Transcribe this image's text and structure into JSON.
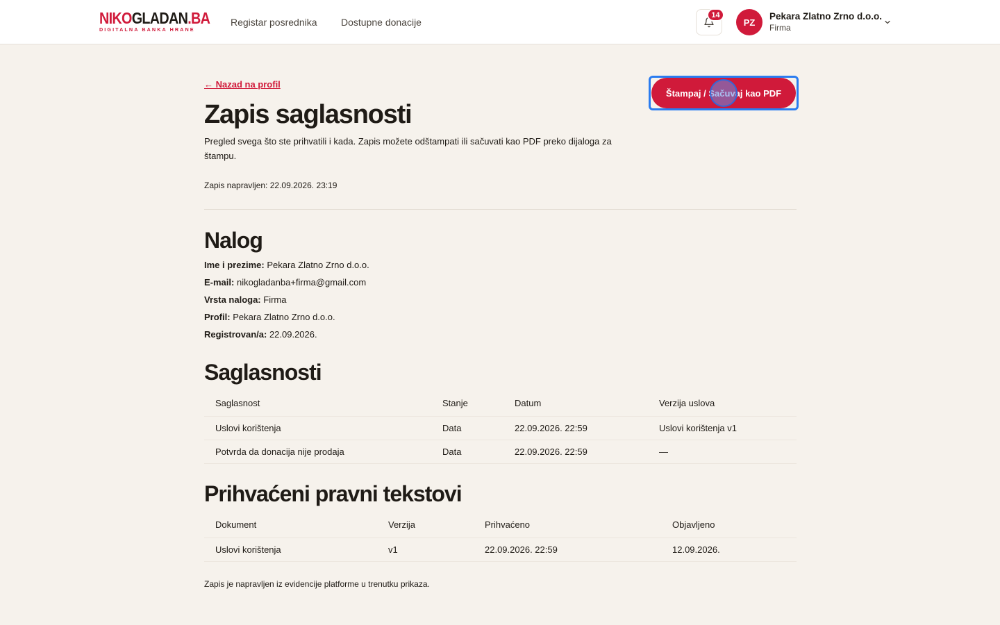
{
  "header": {
    "logo": {
      "part1": "NIKO",
      "part2": "GLADAN",
      "part3": ".BA",
      "tagline": "DIGITALNA BANKA HRANE"
    },
    "nav": [
      {
        "label": "Registar posrednika"
      },
      {
        "label": "Dostupne donacije"
      }
    ],
    "notifications_count": "14",
    "user": {
      "initials": "PZ",
      "name": "Pekara Zlatno Zrno d.o.o.",
      "role": "Firma"
    }
  },
  "page": {
    "back_link": "← Nazad na profil",
    "title": "Zapis saglasnosti",
    "intro": "Pregled svega što ste prihvatili i kada. Zapis možete odštampati ili sačuvati kao PDF preko dijaloga za štampu.",
    "made_at": "Zapis napravljen: 22.09.2026. 23:19",
    "print_button": "Štampaj / Sačuvaj kao PDF"
  },
  "account": {
    "title": "Nalog",
    "fields": [
      {
        "label": "Ime i prezime:",
        "value": "Pekara Zlatno Zrno d.o.o."
      },
      {
        "label": "E-mail:",
        "value": "nikogladanba+firma@gmail.com"
      },
      {
        "label": "Vrsta naloga:",
        "value": "Firma"
      },
      {
        "label": "Profil:",
        "value": "Pekara Zlatno Zrno d.o.o."
      },
      {
        "label": "Registrovan/a:",
        "value": "22.09.2026."
      }
    ]
  },
  "consents": {
    "title": "Saglasnosti",
    "columns": [
      "Saglasnost",
      "Stanje",
      "Datum",
      "Verzija uslova"
    ],
    "rows": [
      [
        "Uslovi korištenja",
        "Data",
        "22.09.2026. 22:59",
        "Uslovi korištenja v1"
      ],
      [
        "Potvrda da donacija nije prodaja",
        "Data",
        "22.09.2026. 22:59",
        "—"
      ]
    ]
  },
  "legal": {
    "title": "Prihvaćeni pravni tekstovi",
    "columns": [
      "Dokument",
      "Verzija",
      "Prihvaćeno",
      "Objavljeno"
    ],
    "rows": [
      [
        "Uslovi korištenja",
        "v1",
        "22.09.2026. 22:59",
        "12.09.2026."
      ]
    ]
  },
  "footer_note": "Zapis je napravljen iz evidencije platforme u trenutku prikaza.",
  "colors": {
    "brand": "#d01a3a",
    "background": "#f6f2ec",
    "focus": "#2a7cf0"
  }
}
